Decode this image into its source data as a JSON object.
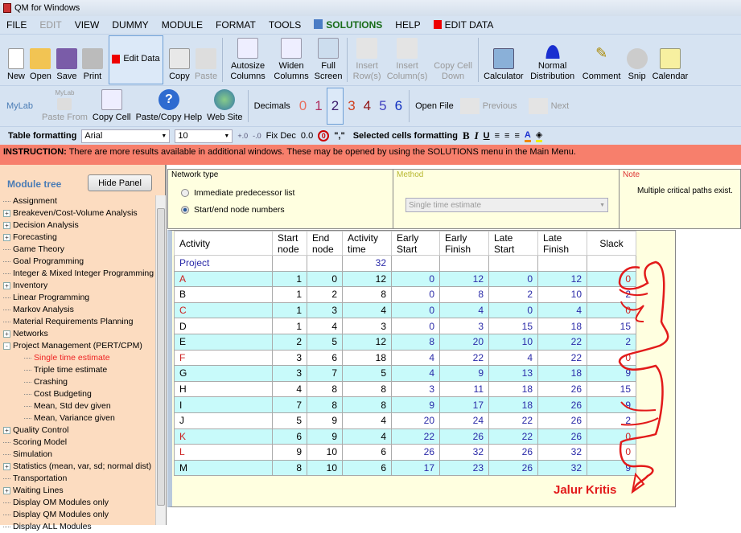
{
  "window": {
    "title": "QM for Windows"
  },
  "menu": [
    "FILE",
    "EDIT",
    "VIEW",
    "DUMMY",
    "MODULE",
    "FORMAT",
    "TOOLS",
    "SOLUTIONS",
    "HELP",
    "EDIT DATA"
  ],
  "toolbar1": {
    "new": "New",
    "open": "Open",
    "save": "Save",
    "print": "Print",
    "edit_data": "Edit Data",
    "copy": "Copy",
    "paste": "Paste",
    "autosize": "Autosize Columns",
    "widen": "Widen Columns",
    "full": "Full Screen",
    "insert_rows": "Insert Row(s)",
    "insert_cols": "Insert Column(s)",
    "copy_down": "Copy Cell Down",
    "calculator": "Calculator",
    "normal": "Normal Distribution",
    "comment": "Comment",
    "snip": "Snip",
    "calendar": "Calendar"
  },
  "toolbar2": {
    "mylab": "MyLab",
    "mylab_icon": "MyLab",
    "paste_from": "Paste From",
    "copy_cell": "Copy Cell",
    "paste_copy_help": "Paste/Copy Help",
    "web_site": "Web Site",
    "decimals": "Decimals",
    "decimal_options": [
      "0",
      "1",
      "2",
      "3",
      "4",
      "5",
      "6"
    ],
    "decimal_selected": "2",
    "open_file": "Open File",
    "previous": "Previous",
    "next": "Next"
  },
  "format": {
    "label": "Table formatting",
    "font": "Arial",
    "size": "10",
    "fix_dec": "Fix Dec",
    "zero": "0.0",
    "comma": "\",\"",
    "selected_label": "Selected cells formatting",
    "bold": "B",
    "italic": "I",
    "underline": "U"
  },
  "instruction": {
    "label": "INSTRUCTION:",
    "text": "There are more results available in additional windows. These may be opened by using the SOLUTIONS menu in the Main Menu."
  },
  "sidebar": {
    "title": "Module tree",
    "hide_button": "Hide Panel",
    "items": [
      {
        "label": "Assignment",
        "exp": ""
      },
      {
        "label": "Breakeven/Cost-Volume Analysis",
        "exp": "+"
      },
      {
        "label": "Decision Analysis",
        "exp": "+"
      },
      {
        "label": "Forecasting",
        "exp": "+"
      },
      {
        "label": "Game Theory",
        "exp": ""
      },
      {
        "label": "Goal Programming",
        "exp": ""
      },
      {
        "label": "Integer & Mixed Integer Programming",
        "exp": ""
      },
      {
        "label": "Inventory",
        "exp": "+"
      },
      {
        "label": "Linear Programming",
        "exp": ""
      },
      {
        "label": "Markov Analysis",
        "exp": ""
      },
      {
        "label": "Material Requirements Planning",
        "exp": ""
      },
      {
        "label": "Networks",
        "exp": "+"
      },
      {
        "label": "Project Management (PERT/CPM)",
        "exp": "-"
      },
      {
        "label": "Single time estimate",
        "sub": true,
        "active": true
      },
      {
        "label": "Triple time estimate",
        "sub": true
      },
      {
        "label": "Crashing",
        "sub": true
      },
      {
        "label": "Cost Budgeting",
        "sub": true
      },
      {
        "label": "Mean, Std dev given",
        "sub": true
      },
      {
        "label": "Mean, Variance given",
        "sub": true
      },
      {
        "label": "Quality Control",
        "exp": "+"
      },
      {
        "label": "Scoring Model",
        "exp": ""
      },
      {
        "label": "Simulation",
        "exp": ""
      },
      {
        "label": "Statistics (mean, var, sd; normal dist)",
        "exp": "+"
      },
      {
        "label": "Transportation",
        "exp": ""
      },
      {
        "label": "Waiting Lines",
        "exp": "+"
      },
      {
        "label": "Display OM Modules only",
        "exp": ""
      },
      {
        "label": "Display QM Modules only",
        "exp": ""
      },
      {
        "label": "Display ALL Modules",
        "exp": ""
      }
    ]
  },
  "options": {
    "network_type_label": "Network type",
    "radio1": "Immediate predecessor list",
    "radio2": "Start/end node numbers",
    "radio_selected": "Start/end node numbers",
    "method_label": "Method",
    "method_value": "Single time estimate",
    "note_label": "Note",
    "note_text": "Multiple critical paths exist."
  },
  "table": {
    "headers": [
      "Activity",
      "Start node",
      "End node",
      "Activity time",
      "Early Start",
      "Early Finish",
      "Late Start",
      "Late Finish",
      "Slack"
    ],
    "project": {
      "label": "Project",
      "time": "32"
    },
    "rows": [
      [
        "A",
        "1",
        "0",
        "12",
        "0",
        "12",
        "0",
        "12",
        "0"
      ],
      [
        "B",
        "1",
        "2",
        "8",
        "0",
        "8",
        "2",
        "10",
        "2"
      ],
      [
        "C",
        "1",
        "3",
        "4",
        "0",
        "4",
        "0",
        "4",
        "0"
      ],
      [
        "D",
        "1",
        "4",
        "3",
        "0",
        "3",
        "15",
        "18",
        "15"
      ],
      [
        "E",
        "2",
        "5",
        "12",
        "8",
        "20",
        "10",
        "22",
        "2"
      ],
      [
        "F",
        "3",
        "6",
        "18",
        "4",
        "22",
        "4",
        "22",
        "0"
      ],
      [
        "G",
        "3",
        "7",
        "5",
        "4",
        "9",
        "13",
        "18",
        "9"
      ],
      [
        "H",
        "4",
        "8",
        "8",
        "3",
        "11",
        "18",
        "26",
        "15"
      ],
      [
        "I",
        "7",
        "8",
        "8",
        "9",
        "17",
        "18",
        "26",
        "9"
      ],
      [
        "J",
        "5",
        "9",
        "4",
        "20",
        "24",
        "22",
        "26",
        "2"
      ],
      [
        "K",
        "6",
        "9",
        "4",
        "22",
        "26",
        "22",
        "26",
        "0"
      ],
      [
        "L",
        "9",
        "10",
        "6",
        "26",
        "32",
        "26",
        "32",
        "0"
      ],
      [
        "M",
        "8",
        "10",
        "6",
        "17",
        "23",
        "26",
        "32",
        "9"
      ]
    ]
  },
  "annotation": {
    "text": "Jalur Kritis",
    "color": "#e21a1a"
  },
  "colors": {
    "instruction_bg": "#f77f6c",
    "panel_bg": "#fcdcc0",
    "critical": "#c22222",
    "computed": "#2a2aa8",
    "row_alt": "#c8fafa"
  }
}
